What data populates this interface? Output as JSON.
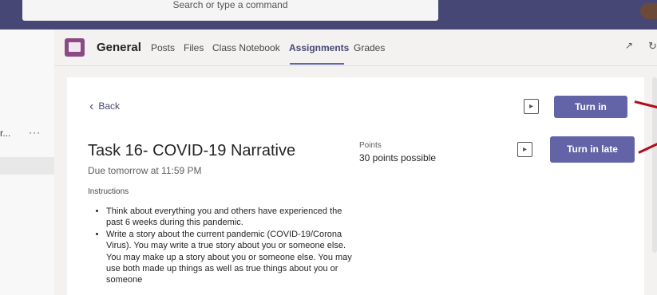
{
  "topbar": {
    "handwriting": ", y",
    "search_placeholder": "Search or type a command"
  },
  "left_rail": {
    "truncated_item": "r...",
    "more": "···"
  },
  "header": {
    "channel": "General",
    "tabs": [
      {
        "label": "Posts"
      },
      {
        "label": "Files"
      },
      {
        "label": "Class Notebook"
      },
      {
        "label": "Assignments",
        "active": true
      },
      {
        "label": "Grades"
      }
    ],
    "expand_icon": "↗",
    "refresh_icon": "↻"
  },
  "assignment": {
    "back_label": "Back",
    "title": "Task 16- COVID-19 Narrative",
    "due": "Due tomorrow at 11:59 PM",
    "points_label": "Points",
    "points_value": "30 points possible",
    "instructions_label": "Instructions",
    "instructions": [
      "Think about everything you and others have experienced the past 6 weeks during this pandemic.",
      "Write a story about the current pandemic (COVID-19/Corona Virus). You may write a true story about you or someone else. You may make up a story about you or someone else. You may use both made up things as well as true things about you or someone"
    ],
    "turn_in_label": "Turn in",
    "turn_in_late_label": "Turn in late",
    "reader_icon": "▸"
  },
  "colors": {
    "accent": "#6264a7",
    "topbar": "#464775",
    "annotation": "#b10e1c"
  }
}
